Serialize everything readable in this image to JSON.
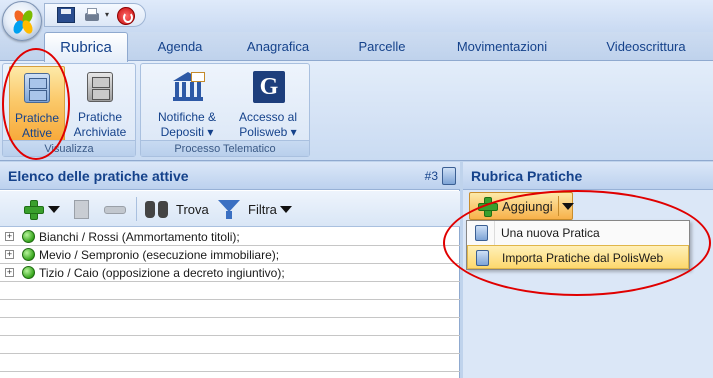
{
  "tabs": [
    {
      "label": "Rubrica"
    },
    {
      "label": "Agenda"
    },
    {
      "label": "Anagrafica"
    },
    {
      "label": "Parcelle"
    },
    {
      "label": "Movimentazioni"
    },
    {
      "label": "Videoscrittura"
    }
  ],
  "ribbon": {
    "groups": {
      "visualizza": {
        "label": "Visualizza",
        "buttons": [
          {
            "label_line1": "Pratiche",
            "label_line2": "Attive",
            "icon": "cabinet-icon"
          },
          {
            "label_line1": "Pratiche",
            "label_line2": "Archiviate",
            "icon": "archive-cabinet-icon"
          }
        ]
      },
      "processo": {
        "label": "Processo Telematico",
        "buttons": [
          {
            "label_line1": "Notifiche &",
            "label_line2": "Depositi ▾",
            "icon": "courthouse-icon"
          },
          {
            "label_line1": "Accesso al",
            "label_line2": "Polisweb ▾",
            "icon": "polisweb-logo-icon",
            "glyph": "G"
          }
        ]
      }
    }
  },
  "left_panel": {
    "title": "Elenco delle pratiche attive",
    "count": "#3",
    "toolbar": {
      "find_label": "Trova",
      "filter_label": "Filtra"
    },
    "rows": [
      {
        "text": "Bianchi / Rossi (Ammortamento titoli);"
      },
      {
        "text": "Mevio / Sempronio (esecuzione immobiliare);"
      },
      {
        "text": "Tizio / Caio (opposizione a decreto ingiuntivo);"
      }
    ]
  },
  "right_panel": {
    "title": "Rubrica Pratiche",
    "add_button": "Aggiungi",
    "menu": [
      {
        "label": "Una nuova Pratica"
      },
      {
        "label": "Importa Pratiche dal PolisWeb"
      }
    ]
  },
  "colors": {
    "accent": "#15428b",
    "highlight": "#fbc96a",
    "annotation": "#e00000"
  }
}
